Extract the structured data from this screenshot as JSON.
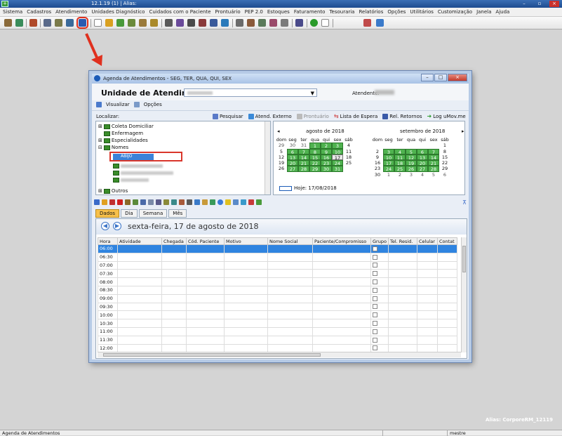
{
  "app": {
    "title": "12.1.19 (1) | Alias:"
  },
  "menu": [
    "Sistema",
    "Cadastros",
    "Atendimento",
    "Unidades Diagnóstico",
    "Cuidados com o Paciente",
    "Prontuário",
    "PEP 2.0",
    "Estoques",
    "Faturamento",
    "Tesouraria",
    "Relatórios",
    "Opções",
    "Utilitários",
    "Customização",
    "Janela",
    "Ajuda"
  ],
  "dialog": {
    "title": "Agenda de Atendimentos - SEG, TER, QUA, QUI, SEX",
    "unit_label": "Unidade de Atendimento",
    "atendente_label": "Atendente:",
    "visualizar": "Visualizar",
    "opcoes": "Opções",
    "localizar": "Localizar:",
    "actions": [
      "Pesquisar",
      "Atend. Externo",
      "Prontuário",
      "Lista de Espera",
      "Rel. Retornos",
      "Log uMov.me"
    ],
    "tree": [
      "Coleta Domiciliar",
      "Enfermagem",
      "Especialidades",
      "Nomes",
      "ABIJO",
      "Outros"
    ],
    "cal": {
      "month1": "agosto de 2018",
      "month2": "setembro de 2018",
      "weekdays": [
        "dom",
        "seg",
        "ter",
        "qua",
        "qui",
        "sex",
        "sáb"
      ],
      "hoje": "Hoje: 17/08/2018"
    },
    "tabs": [
      "Dados",
      "Dia",
      "Semana",
      "Mês"
    ],
    "date": "sexta-feira, 17 de agosto de 2018",
    "columns": [
      "Hora",
      "Atividade",
      "Chegada",
      "Cód. Paciente",
      "Motivo",
      "Nome Social",
      "Paciente/Compromisso",
      "Grupo",
      "Tel. Resid.",
      "Celular",
      "Contat"
    ],
    "times": [
      "06:00",
      "06:30",
      "07:00",
      "07:30",
      "08:00",
      "08:30",
      "09:00",
      "09:30",
      "10:00",
      "10:30",
      "11:00",
      "11:30",
      "12:00"
    ]
  },
  "alias_watermark": "Alias: CorporeRM_12119",
  "status": {
    "left": "Agenda de Atendimentos",
    "right": "mestre"
  },
  "colors": {
    "green": "#4fb24f",
    "blue": "#2f84e0",
    "red": "#e0301e"
  }
}
